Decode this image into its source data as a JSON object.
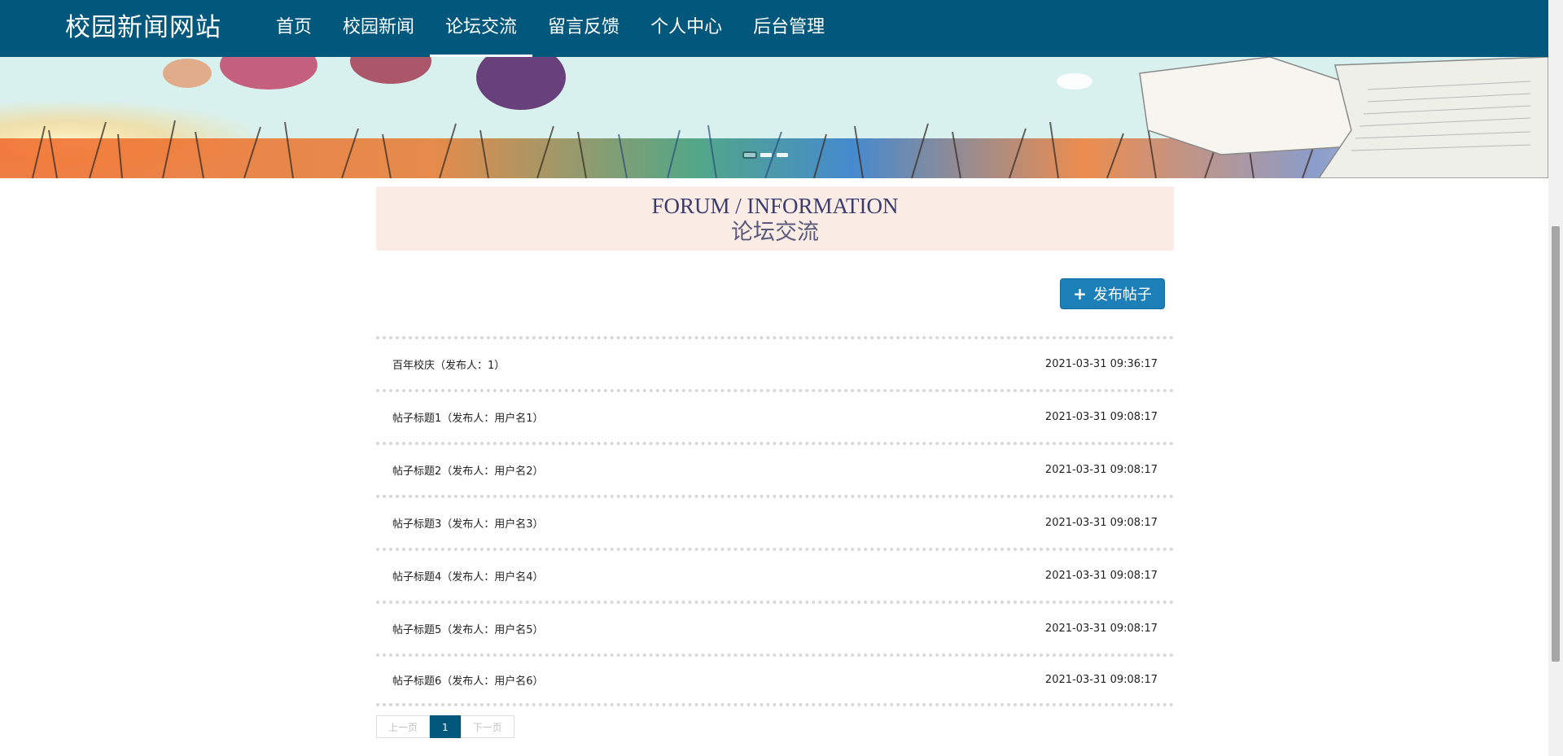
{
  "site": {
    "brand": "校园新闻网站"
  },
  "nav": {
    "items": [
      {
        "label": "首页"
      },
      {
        "label": "校园新闻"
      },
      {
        "label": "论坛交流",
        "active": true
      },
      {
        "label": "留言反馈"
      },
      {
        "label": "个人中心"
      },
      {
        "label": "后台管理"
      }
    ]
  },
  "banner": {
    "slides": 3,
    "active_slide": 1
  },
  "section": {
    "title_en": "FORUM / INFORMATION",
    "title_cn": "论坛交流"
  },
  "actions": {
    "publish_label": "发布帖子",
    "publish_icon": "plus-icon"
  },
  "posts": [
    {
      "title": "百年校庆（发布人：1）",
      "time": "2021-03-31 09:36:17"
    },
    {
      "title": "帖子标题1（发布人：用户名1）",
      "time": "2021-03-31 09:08:17"
    },
    {
      "title": "帖子标题2（发布人：用户名2）",
      "time": "2021-03-31 09:08:17"
    },
    {
      "title": "帖子标题3（发布人：用户名3）",
      "time": "2021-03-31 09:08:17"
    },
    {
      "title": "帖子标题4（发布人：用户名4）",
      "time": "2021-03-31 09:08:17"
    },
    {
      "title": "帖子标题5（发布人：用户名5）",
      "time": "2021-03-31 09:08:17"
    },
    {
      "title": "帖子标题6（发布人：用户名6）",
      "time": "2021-03-31 09:08:17"
    }
  ],
  "pagination": {
    "prev_label": "上一页",
    "current_page": "1",
    "next_label": "下一页"
  },
  "colors": {
    "nav_bg": "#01587c",
    "accent": "#1d7fb8",
    "section_bg": "#fbede6"
  }
}
